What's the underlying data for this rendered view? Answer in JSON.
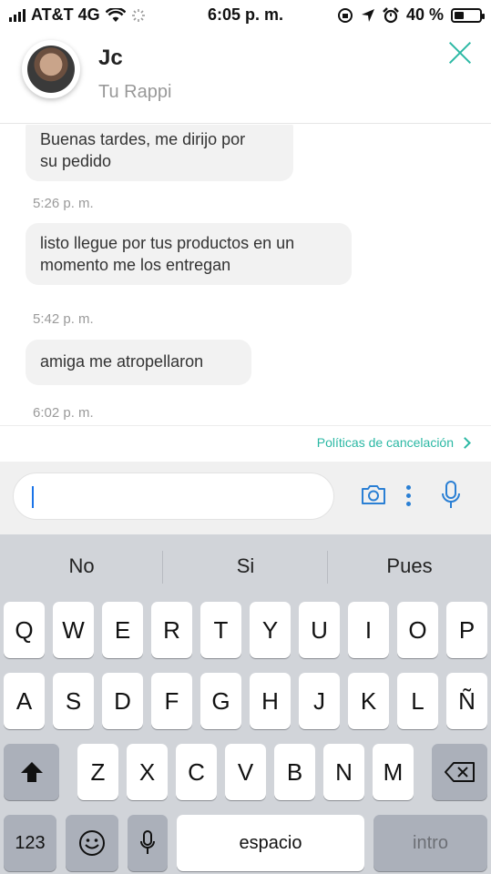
{
  "status_bar": {
    "carrier": "AT&T 4G",
    "time": "6:05 p. m.",
    "battery": "40 %",
    "battery_level": 0.4
  },
  "header": {
    "contact_name": "Jc",
    "subtitle": "Tu Rappi"
  },
  "messages": [
    {
      "text_line1": "Buenas tardes, me dirijo por",
      "text_line2": "su pedido",
      "time": "5:26 p. m."
    },
    {
      "text_line1": "listo llegue por tus productos en un",
      "text_line2": "momento me los entregan",
      "time": "5:42 p. m."
    },
    {
      "text_line1": "amiga me atropellaron",
      "time": "6:02 p. m."
    }
  ],
  "policy_link": "Políticas de cancelación",
  "input": {
    "value": ""
  },
  "keyboard": {
    "suggestions": [
      "No",
      "Si",
      "Pues"
    ],
    "row1": [
      "Q",
      "W",
      "E",
      "R",
      "T",
      "Y",
      "U",
      "I",
      "O",
      "P"
    ],
    "row2": [
      "A",
      "S",
      "D",
      "F",
      "G",
      "H",
      "J",
      "K",
      "L",
      "Ñ"
    ],
    "row3": [
      "Z",
      "X",
      "C",
      "V",
      "B",
      "N",
      "M"
    ],
    "numbers_key": "123",
    "space_key": "espacio",
    "return_key": "intro"
  },
  "colors": {
    "accent": "#2bb8a4",
    "icon_blue": "#2a7fd4",
    "keyboard_bg": "#d1d4d9"
  }
}
